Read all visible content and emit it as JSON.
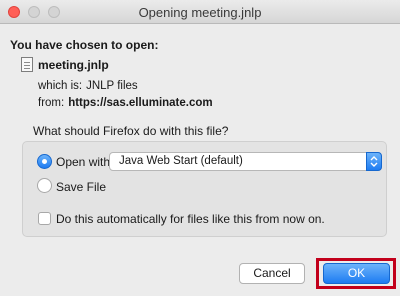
{
  "window": {
    "title": "Opening meeting.jnlp"
  },
  "heading": "You have chosen to open:",
  "file": {
    "name": "meeting.jnlp",
    "type_label": "which is:",
    "type_value": "JNLP files",
    "from_label": "from:",
    "from_value": "https://sas.elluminate.com"
  },
  "question": "What should Firefox do with this file?",
  "options": {
    "open_with_label": "Open with",
    "open_with_selected": true,
    "app_selected": "Java Web Start (default)",
    "save_file_label": "Save File",
    "save_file_selected": false
  },
  "auto_checkbox": {
    "label": "Do this automatically for files like this from now on.",
    "checked": false
  },
  "buttons": {
    "cancel": "Cancel",
    "ok": "OK"
  },
  "colors": {
    "accent": "#1e7cf2",
    "close_light": "#ff5f57",
    "highlight_box": "#c2001b"
  }
}
